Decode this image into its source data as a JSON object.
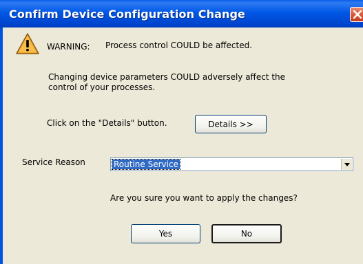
{
  "dialog": {
    "title": "Confirm Device Configuration Change",
    "warning_label": "WARNING:",
    "warning_text": "Process control COULD be affected.",
    "message_line1": "Changing device parameters COULD adversely affect the",
    "message_line2": "control of your processes.",
    "details_hint": "Click on the \"Details\" button.",
    "details_button": "Details >>",
    "service_reason_label": "Service Reason",
    "service_reason_value": "Routine Service",
    "question": "Are you sure you want to apply the changes?",
    "yes_button": "Yes",
    "no_button": "No"
  },
  "icons": {
    "warning": "warning-triangle-icon",
    "close": "close-icon",
    "dropdown": "chevron-down-icon"
  },
  "colors": {
    "titlebar": "#0058e6",
    "title_text": "#ffffff",
    "selection": "#316ac5",
    "dialog_bg": "#ece9d8",
    "close_button": "#d8512f",
    "warning_fill": "#f0a020"
  }
}
